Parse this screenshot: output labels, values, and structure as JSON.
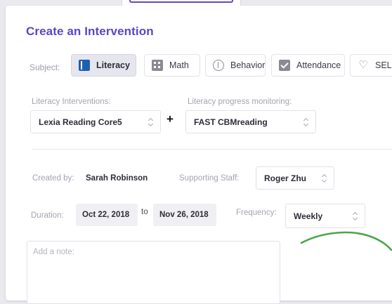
{
  "form": {
    "title": "Create an Intervention",
    "subject_label": "Subject:",
    "subjects": [
      {
        "label": "Literacy",
        "icon": "book-icon",
        "active": true
      },
      {
        "label": "Math",
        "icon": "calculator-icon",
        "active": false
      },
      {
        "label": "Behavior",
        "icon": "brain-icon",
        "active": false
      },
      {
        "label": "Attendance",
        "icon": "checkbox-icon",
        "active": false
      },
      {
        "label": "SEL",
        "icon": "heart-icon",
        "active": false
      }
    ],
    "interventions_label": "Literacy Interventions:",
    "intervention_value": "Lexia Reading Core5",
    "plus_symbol": "+",
    "progress_label": "Literacy progress monitoring:",
    "progress_value": "FAST CBMreading",
    "created_by_label": "Created by:",
    "created_by_value": "Sarah Robinson",
    "supporting_staff_label": "Supporting Staff:",
    "supporting_staff_value": "Roger Zhu",
    "duration_label": "Duration:",
    "start_date": "Oct 22, 2018",
    "to_label": "to",
    "end_date": "Nov 26, 2018",
    "frequency_label": "Frequency:",
    "frequency_value": "Weekly",
    "note_placeholder": "Add a note:"
  },
  "colors": {
    "accent": "#5847c8",
    "literacy_icon": "#1f5fb0",
    "scribble": "#4aa64a"
  }
}
